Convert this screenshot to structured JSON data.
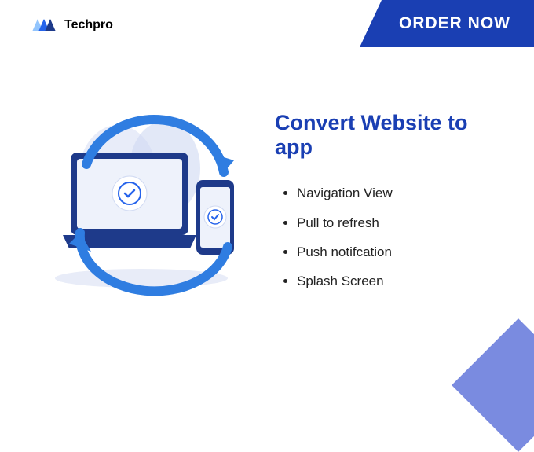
{
  "brand": "Techpro",
  "cta": "ORDER NOW",
  "heading": "Convert Website to app",
  "features": [
    "Navigation View",
    "Pull to refresh",
    "Push notifcation",
    "Splash Screen"
  ],
  "colors": {
    "primary": "#1a3fb3",
    "accent": "#7a8be0",
    "logoBlue": "#2563eb",
    "logoLight": "#93c5fd",
    "logoDark": "#1e3a8a"
  }
}
